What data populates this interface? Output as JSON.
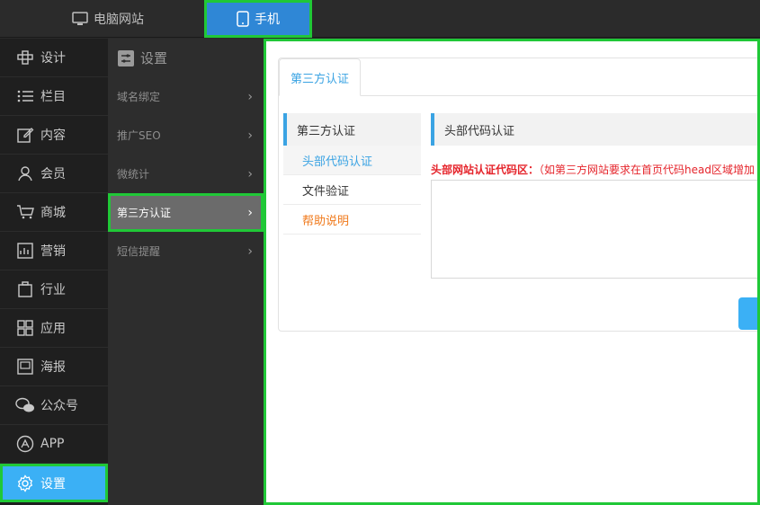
{
  "topbar": {
    "pc_label": "电脑网站",
    "mobile_label": "手机"
  },
  "leftnav": {
    "items": [
      {
        "label": "设计",
        "icon": "design-icon"
      },
      {
        "label": "栏目",
        "icon": "list-icon"
      },
      {
        "label": "内容",
        "icon": "edit-icon"
      },
      {
        "label": "会员",
        "icon": "user-icon"
      },
      {
        "label": "商城",
        "icon": "cart-icon"
      },
      {
        "label": "营销",
        "icon": "chart-icon"
      },
      {
        "label": "行业",
        "icon": "briefcase-icon"
      },
      {
        "label": "应用",
        "icon": "grid-icon"
      },
      {
        "label": "海报",
        "icon": "poster-icon"
      },
      {
        "label": "公众号",
        "icon": "wechat-icon"
      },
      {
        "label": "APP",
        "icon": "app-store-icon"
      },
      {
        "label": "设置",
        "icon": "gear-icon"
      }
    ],
    "active_index": 11
  },
  "subnav": {
    "title": "设置",
    "items": [
      {
        "label": "域名绑定"
      },
      {
        "label": "推广SEO"
      },
      {
        "label": "微统计"
      },
      {
        "label": "第三方认证"
      },
      {
        "label": "短信提醒"
      }
    ],
    "active_index": 3
  },
  "main": {
    "tab_label": "第三方认证",
    "side_menu": {
      "title": "第三方认证",
      "links": [
        {
          "label": "头部代码认证",
          "state": "active"
        },
        {
          "label": "文件验证",
          "state": "normal"
        },
        {
          "label": "帮助说明",
          "state": "help"
        }
      ]
    },
    "content": {
      "title": "头部代码认证",
      "label_bold": "头部网站认证代码区：",
      "label_hint": "（如第三方网站要求在首页代码head区域增加",
      "code_value": ""
    }
  },
  "colors": {
    "accent": "#3bb0f5",
    "highlight_border": "#20c837",
    "link_blue": "#3aa3e3",
    "warning_red": "#e5242b",
    "help_orange": "#f07a1c"
  }
}
